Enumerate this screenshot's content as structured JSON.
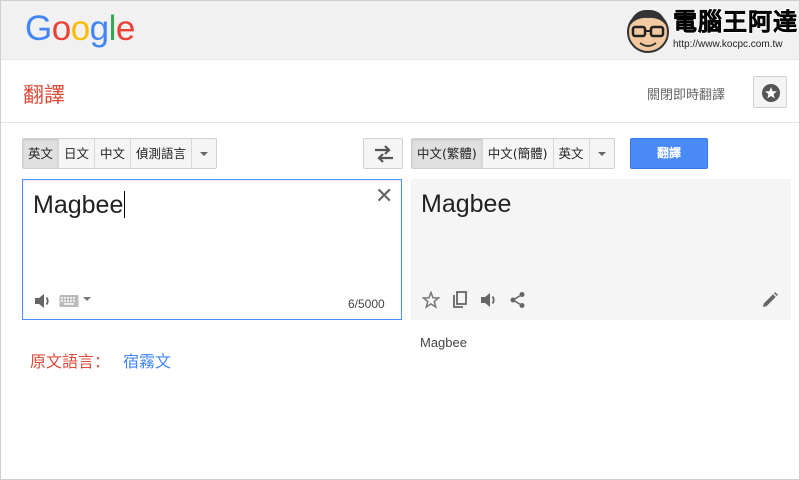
{
  "logo": {
    "letters": [
      "G",
      "o",
      "o",
      "g",
      "l",
      "e"
    ],
    "colors": [
      "#4285f4",
      "#ea4335",
      "#fbbc05",
      "#4285f4",
      "#34a853",
      "#ea4335"
    ]
  },
  "watermark": {
    "title": "電腦王阿達",
    "url": "http://www.kocpc.com.tw"
  },
  "header": {
    "title": "翻譯",
    "instant_toggle": "關閉即時翻譯",
    "star_icon": "star-icon"
  },
  "source_langs": [
    "英文",
    "日文",
    "中文",
    "偵測語言"
  ],
  "source_active": 0,
  "target_langs": [
    "中文(繁體)",
    "中文(簡體)",
    "英文"
  ],
  "target_active": 0,
  "translate_label": "翻譯",
  "source": {
    "text": "Magbee",
    "char_count": "6/5000"
  },
  "result": {
    "text": "Magbee",
    "romanization": "Magbee"
  },
  "detected": {
    "label": "原文語言：",
    "language": "宿霧文"
  },
  "colors": {
    "accent_red": "#dd4b39",
    "accent_blue": "#4a8af4",
    "link_blue": "#4285f4"
  }
}
